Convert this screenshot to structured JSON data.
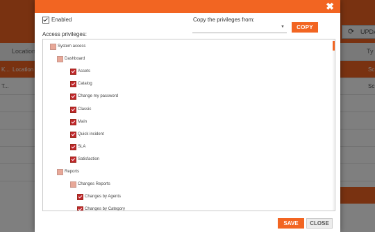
{
  "background": {
    "update_label": "UPDAT",
    "columns": [
      "Location",
      "Ty"
    ],
    "rows": [
      {
        "c1": "K...",
        "c2": "Location c",
        "c3": "Sc"
      },
      {
        "c1": "T...",
        "c2": "",
        "c3": "Sc"
      }
    ]
  },
  "dialog": {
    "enabled_label": "Enabled",
    "enabled_checked": true,
    "access_privileges_label": "Access privileges:",
    "copy_from_label": "Copy the privileges from:",
    "copy_select_value": "",
    "copy_button": "COPY",
    "save_button": "SAVE",
    "close_button": "CLOSE",
    "close_icon": "✖",
    "tree": [
      {
        "label": "System access",
        "level": 0,
        "state": "partial"
      },
      {
        "label": "Dashboard",
        "level": 1,
        "state": "partial"
      },
      {
        "label": "Assets",
        "level": 2,
        "state": "checked"
      },
      {
        "label": "Catalog",
        "level": 2,
        "state": "checked"
      },
      {
        "label": "Change my password",
        "level": 2,
        "state": "checked"
      },
      {
        "label": "Classic",
        "level": 2,
        "state": "checked"
      },
      {
        "label": "Main",
        "level": 2,
        "state": "checked"
      },
      {
        "label": "Quick incident",
        "level": 2,
        "state": "checked"
      },
      {
        "label": "SLA",
        "level": 2,
        "state": "checked"
      },
      {
        "label": "Satisfaction",
        "level": 2,
        "state": "checked"
      },
      {
        "label": "Reports",
        "level": 1,
        "state": "partial"
      },
      {
        "label": "Changes Reports",
        "level": 2,
        "state": "partial"
      },
      {
        "label": "Changes by Agents",
        "level": 3,
        "state": "checked"
      },
      {
        "label": "Changes by Category",
        "level": 3,
        "state": "checked"
      }
    ]
  },
  "colors": {
    "accent": "#f26522",
    "checked": "#c1272d",
    "partial": "#e8a898"
  }
}
